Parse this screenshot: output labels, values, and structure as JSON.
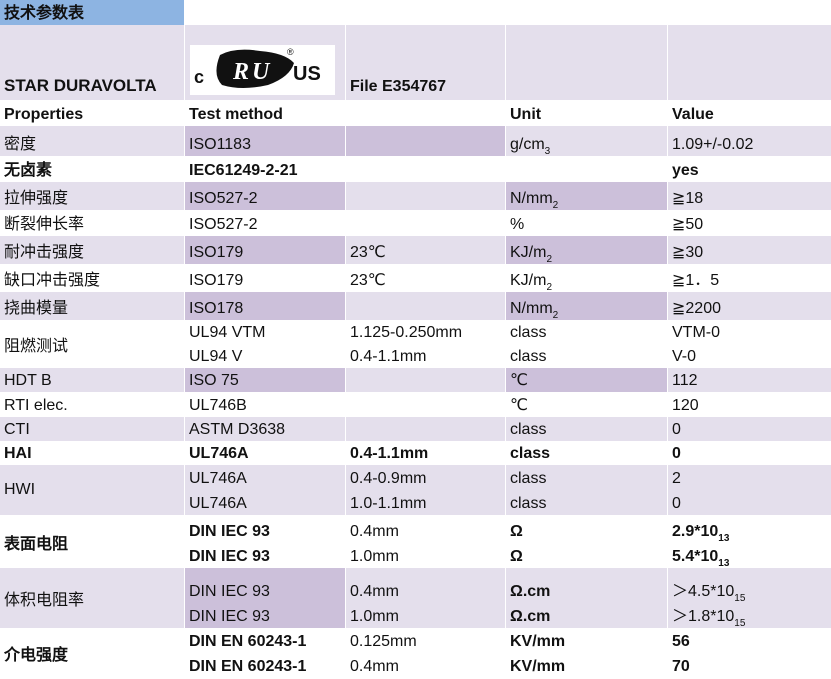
{
  "title": "技术参数表",
  "brand": "STAR DURAVOLTA",
  "cert": {
    "c": "c",
    "us": "US",
    "reg": "®",
    "file": "File E354767",
    "mark": "UL recognized component mark"
  },
  "headers": [
    "Properties",
    "Test method",
    "",
    "Unit",
    "Value"
  ],
  "rows": [
    {
      "prop": "密度",
      "method": "ISO1183",
      "cond": "",
      "unit": "g/cm",
      "unit_sup": "3",
      "value": "1.09+/-0.02",
      "value_sup": ""
    },
    {
      "prop": "无卤素",
      "method": "IEC61249-2-21",
      "cond": "",
      "unit": "",
      "unit_sup": "",
      "value": "yes",
      "value_sup": ""
    },
    {
      "prop": "拉伸强度",
      "method": "ISO527-2",
      "cond": "",
      "unit": "N/mm",
      "unit_sup": "2",
      "value": "≧18",
      "value_sup": ""
    },
    {
      "prop": "断裂伸长率",
      "method": "ISO527-2",
      "cond": "",
      "unit": "%",
      "unit_sup": "",
      "value": "≧50",
      "value_sup": ""
    },
    {
      "prop": "耐冲击强度",
      "method": "ISO179",
      "cond": "23℃",
      "unit": "KJ/m",
      "unit_sup": "2",
      "value": "≧30",
      "value_sup": ""
    },
    {
      "prop": "缺口冲击强度",
      "method": "ISO179",
      "cond": "23℃",
      "unit": "KJ/m",
      "unit_sup": "2",
      "value": "≧1．5",
      "value_sup": ""
    },
    {
      "prop": "挠曲模量",
      "method": "ISO178",
      "cond": "",
      "unit": "N/mm",
      "unit_sup": "2",
      "value": "≧2200",
      "value_sup": ""
    }
  ],
  "flame": {
    "prop": "阻燃测试",
    "lines": [
      {
        "method": "UL94 VTM",
        "cond": "1.125-0.250mm",
        "unit": "class",
        "value": "VTM-0"
      },
      {
        "method": "UL94 V",
        "cond": "0.4-1.1mm",
        "unit": "class",
        "value": "V-0"
      }
    ]
  },
  "rows2": [
    {
      "prop": "HDT B",
      "method": "ISO 75",
      "cond": "",
      "unit": "℃",
      "value": "112"
    },
    {
      "prop": "RTI  elec.",
      "method": "UL746B",
      "cond": "",
      "unit": "℃",
      "value": "120"
    },
    {
      "prop": "CTI",
      "method": "ASTM D3638",
      "cond": "",
      "unit": "class",
      "value": "0"
    },
    {
      "prop": "HAI",
      "method": "UL746A",
      "cond": "0.4-1.1mm",
      "unit": "class",
      "value": "0"
    }
  ],
  "hwi": {
    "prop": "HWI",
    "lines": [
      {
        "method": "UL746A",
        "cond": "0.4-0.9mm",
        "unit": "class",
        "value": "2"
      },
      {
        "method": "UL746A",
        "cond": "1.0-1.1mm",
        "unit": "class",
        "value": "0"
      }
    ]
  },
  "surface": {
    "prop": "表面电阻",
    "lines": [
      {
        "method": "DIN IEC 93",
        "cond": "0.4mm",
        "unit": "Ω",
        "value": "2.9*10",
        "sup": "13"
      },
      {
        "method": "DIN IEC 93",
        "cond": "1.0mm",
        "unit": "Ω",
        "value": "5.4*10",
        "sup": "13"
      }
    ]
  },
  "volume": {
    "prop": "体积电阻率",
    "lines": [
      {
        "method": "DIN IEC 93",
        "cond": "0.4mm",
        "unit": "Ω.cm",
        "value": "＞4.5*10",
        "sup": "15"
      },
      {
        "method": "DIN IEC 93",
        "cond": "1.0mm",
        "unit": "Ω.cm",
        "value": "＞1.8*10",
        "sup": "15"
      }
    ]
  },
  "dielectric": {
    "prop": "介电强度",
    "lines": [
      {
        "method": "DIN EN 60243-1",
        "cond": "0.125mm",
        "unit": "KV/mm",
        "value": "56"
      },
      {
        "method": "DIN EN 60243-1",
        "cond": "0.4mm",
        "unit": "KV/mm",
        "value": "70"
      }
    ]
  }
}
